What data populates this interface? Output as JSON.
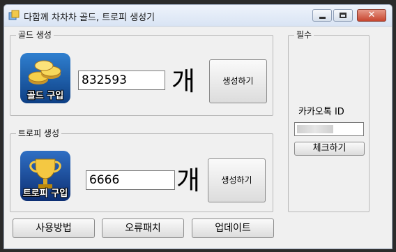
{
  "window": {
    "title": "다함께 차차차 골드, 트로피 생성기"
  },
  "gold": {
    "group_title": "골드 생성",
    "icon_label": "골드 구입",
    "amount": "832593",
    "unit": "개",
    "generate_label": "생성하기"
  },
  "trophy": {
    "group_title": "트로피 생성",
    "icon_label": "트로피 구입",
    "amount": "6666",
    "unit": "개",
    "generate_label": "생성하기"
  },
  "required": {
    "group_title": "필수",
    "kakao_label": "카카오톡 ID",
    "kakao_id": "",
    "check_label": "체크하기"
  },
  "bottom": {
    "usage_label": "사용방법",
    "patch_label": "오류패치",
    "update_label": "업데이트"
  },
  "icons": [
    "app-icon",
    "minimize-icon",
    "maximize-icon",
    "close-icon",
    "gold-coins-icon",
    "trophy-icon"
  ]
}
